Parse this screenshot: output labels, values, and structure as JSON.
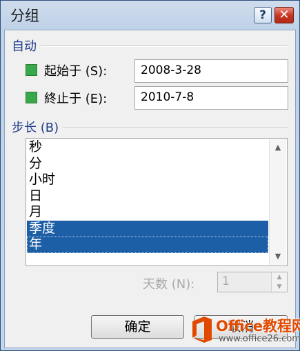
{
  "window": {
    "title": "分组",
    "help_label": "?",
    "close_label": "✕"
  },
  "auto_group": {
    "label": "自动",
    "start": {
      "label": "起始于 (S):",
      "value": "2008-3-28",
      "checked": true
    },
    "end": {
      "label": "終止于 (E):",
      "value": "2010-7-8",
      "checked": true
    }
  },
  "step_group": {
    "label": "步长 (B)",
    "items": [
      {
        "label": "秒",
        "selected": false
      },
      {
        "label": "分",
        "selected": false
      },
      {
        "label": "小时",
        "selected": false
      },
      {
        "label": "日",
        "selected": false
      },
      {
        "label": "月",
        "selected": false
      },
      {
        "label": "季度",
        "selected": true
      },
      {
        "label": "年",
        "selected": true
      }
    ]
  },
  "days": {
    "label": "天数 (N):",
    "value": "1",
    "enabled": false
  },
  "buttons": {
    "ok": "确定",
    "cancel": "取消"
  },
  "watermark": {
    "title": "Office教程网",
    "url": "www.office26.com"
  },
  "colors": {
    "selection": "#1d5fa6",
    "checkbox": "#38a84a",
    "group_label": "#1f3c8a",
    "watermark": "#e04a00"
  }
}
